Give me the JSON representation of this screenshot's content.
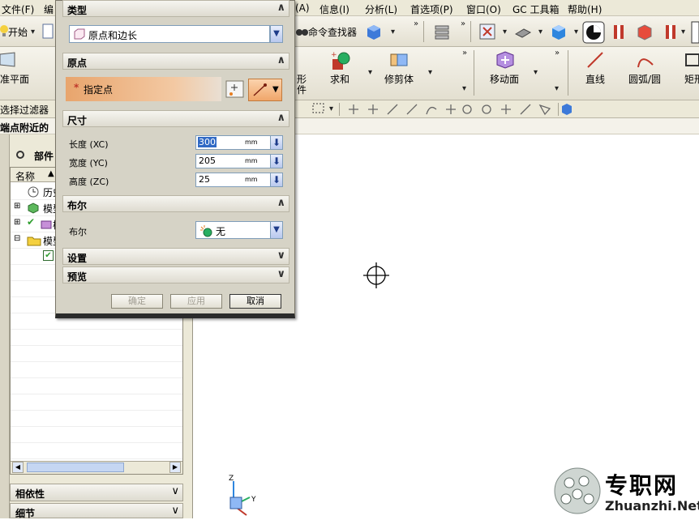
{
  "menubar": {
    "items": [
      "文件(F)",
      "编",
      "(A)",
      "信息(I)",
      "分析(L)",
      "首选项(P)",
      "窗口(O)",
      "GC 工具箱",
      "帮助(H)"
    ]
  },
  "toolbar1": {
    "start_label": "开始",
    "cmd_finder_label": "命令查找器"
  },
  "toolbar2": {
    "datum_plane_label": "准平面",
    "shape_label": "形",
    "feature_label": "件",
    "unite_label": "求和",
    "trim_label": "修剪体",
    "move_face_label": "移动面",
    "line_label": "直线",
    "arc_label": "圆弧/圆",
    "rect_label": "矩形"
  },
  "toolbar3": {
    "filter_label": "选择过滤器"
  },
  "leftpanel": {
    "snap_text": "端点附近的",
    "title": "部件",
    "column_name": "名称",
    "tree": [
      "历史",
      "模型",
      "模型",
      "模型"
    ],
    "bottom_sections": [
      "相依性",
      "细节"
    ]
  },
  "dialog": {
    "sections": {
      "type": "类型",
      "origin": "原点",
      "dimensions": "尺寸",
      "boolean": "布尔",
      "settings": "设置",
      "preview": "预览"
    },
    "type_value": "原点和边长",
    "specify_point_label": "指定点",
    "required_mark": "*",
    "length_label": "长度 (XC)",
    "length_value": "300",
    "length_unit": "mm",
    "width_label": "宽度 (YC)",
    "width_value": "205",
    "width_unit": "mm",
    "height_label": "高度 (ZC)",
    "height_value": "25",
    "height_unit": "mm",
    "boolean_label": "布尔",
    "boolean_value": "无",
    "ok_label": "确定",
    "apply_label": "应用",
    "cancel_label": "取消"
  },
  "watermark": {
    "cn": "专职网",
    "url": "Zhuanzhi.Net"
  },
  "triad": {
    "z": "Z",
    "y": "Y"
  },
  "colors": {
    "accent_orange": "#e8a56d",
    "dd_blue": "#1e3c8a"
  }
}
